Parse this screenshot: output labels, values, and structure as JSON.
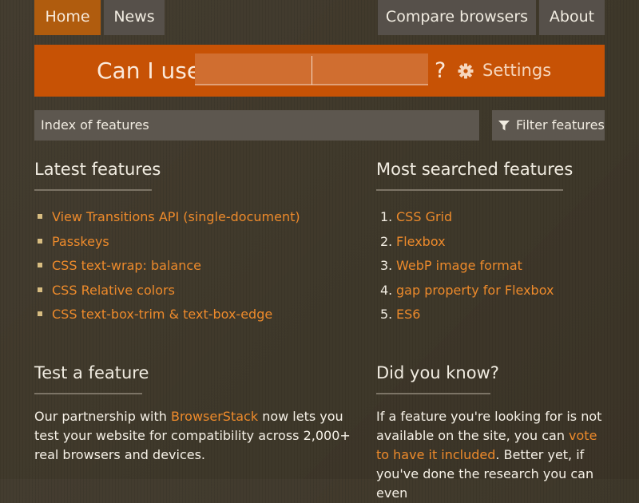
{
  "nav": {
    "home": "Home",
    "news": "News",
    "compare": "Compare browsers",
    "about": "About"
  },
  "search": {
    "label": "Can I use",
    "value": "",
    "question_mark": "?",
    "settings": "Settings"
  },
  "index_label": "Index of features",
  "filter_label": "Filter features",
  "latest": {
    "title": "Latest features",
    "items": [
      "View Transitions API (single-document)",
      "Passkeys",
      "CSS text-wrap: balance",
      "CSS Relative colors",
      "CSS text-box-trim & text-box-edge"
    ]
  },
  "most_searched": {
    "title": "Most searched features",
    "items": [
      {
        "num": "1.",
        "label": "CSS Grid"
      },
      {
        "num": "2.",
        "label": "Flexbox"
      },
      {
        "num": "3.",
        "label": "WebP image format"
      },
      {
        "num": "4.",
        "label": "gap property for Flexbox"
      },
      {
        "num": "5.",
        "label": "ES6"
      }
    ]
  },
  "test": {
    "title": "Test a feature",
    "text_before": "Our partnership with ",
    "link": "BrowserStack",
    "text_after": " now lets you test your website for compatibility across 2,000+ real browsers and devices."
  },
  "did_you_know": {
    "title": "Did you know?",
    "text_before": "If a feature you're looking for is not available on the site, you can ",
    "link": "vote to have it included",
    "text_after": ". Better yet, if you've done the research you can even"
  },
  "colors": {
    "background": "#3e3729",
    "accent": "#c75205",
    "link": "#ed8a2b",
    "home_active": "#b05c0e"
  }
}
